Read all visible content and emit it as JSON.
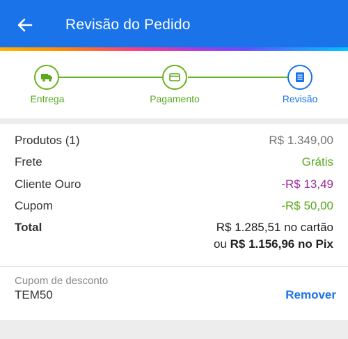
{
  "header": {
    "title": "Revisão do Pedido",
    "back_icon": "arrow-left-icon"
  },
  "stepper": {
    "steps": [
      {
        "label": "Entrega",
        "icon": "truck-icon",
        "state": "done"
      },
      {
        "label": "Pagamento",
        "icon": "card-icon",
        "state": "done"
      },
      {
        "label": "Revisão",
        "icon": "receipt-icon",
        "state": "current"
      }
    ]
  },
  "summary": {
    "products": {
      "label": "Produtos (1)",
      "value": "R$ 1.349,00"
    },
    "shipping": {
      "label": "Frete",
      "value": "Grátis"
    },
    "gold": {
      "label": "Cliente Ouro",
      "value": "-R$ 13,49"
    },
    "coupon": {
      "label": "Cupom",
      "value": "-R$ 50,00"
    },
    "total": {
      "label": "Total",
      "card_value": "R$ 1.285,51",
      "card_suffix": "no cartão",
      "pix_prefix": "ou",
      "pix_value": "R$ 1.156,96 no Pix"
    }
  },
  "coupon_section": {
    "label": "Cupom de desconto",
    "code": "TEM50",
    "remove_label": "Remover"
  },
  "colors": {
    "primary": "#1a73e8",
    "success": "#5aa91f",
    "discount": "#9c2b9c"
  }
}
